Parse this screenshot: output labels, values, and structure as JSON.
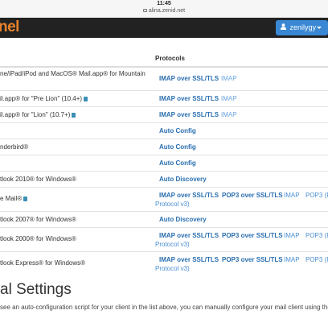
{
  "statusbar": {
    "time": "11:45",
    "url": "alina.zenid.net"
  },
  "navbar": {
    "brand": "nel",
    "user_label": "zenilygy"
  },
  "table": {
    "protocols_header": "Protocols",
    "rows": [
      {
        "client_line1": "ne/iPad/iPod and MacOS® Mail.app® for Mountain",
        "client_line2": "",
        "p1": "IMAP over SSL/TLS",
        "p2": "IMAP"
      },
      {
        "client_line1": "il.app® for \"Pre Lion\" (10.4+)",
        "p1": "IMAP over SSL/TLS",
        "p2": "IMAP"
      },
      {
        "client_line1": "il.app® for \"Lion\" (10.7+)",
        "p1": "IMAP over SSL/TLS",
        "p2": "IMAP"
      },
      {
        "client_line1": "",
        "p1": "Auto Config"
      },
      {
        "client_line1": "nderbird®",
        "p1": "Auto Config"
      },
      {
        "client_line1": "",
        "p1": "Auto Config"
      },
      {
        "client_line1": "tlook 2010® for Windows®",
        "p1": "Auto Discovery"
      },
      {
        "client_line1": "e Mail®",
        "p1": "IMAP over SSL/TLS",
        "p2": "POP3 over SSL/TLS",
        "p3": "IMAP",
        "p4": "POP3 (P",
        "p5": "Protocol v3)"
      },
      {
        "client_line1": "tlook 2007® for Windows®",
        "p1": "Auto Discovery"
      },
      {
        "client_line1": "tlook 2000® for Windows®",
        "p1": "IMAP over SSL/TLS",
        "p2": "POP3 over SSL/TLS",
        "p3": "IMAP",
        "p4": "POP3 (P",
        "p5": "Protocol v3)"
      },
      {
        "client_line1": "tlook Express® for Windows®",
        "p1": "IMAP over SSL/TLS",
        "p2": "POP3 over SSL/TLS",
        "p3": "IMAP",
        "p4": "POP3 (P",
        "p5": "Protocol v3)"
      }
    ]
  },
  "settings": {
    "title": "al Settings",
    "text": "see an auto-configuration script for your client in the list above, you can manually configure your mail client using the"
  },
  "colors": {
    "nav_bg": "#222222",
    "brand": "#e8822a",
    "user_button": "#3a87d4",
    "link": "#2a6fb0"
  },
  "icons": {
    "user": "user-icon",
    "caret": "chevron-down-icon",
    "lock": "lock-icon",
    "flag": "apple-flag-icon"
  }
}
